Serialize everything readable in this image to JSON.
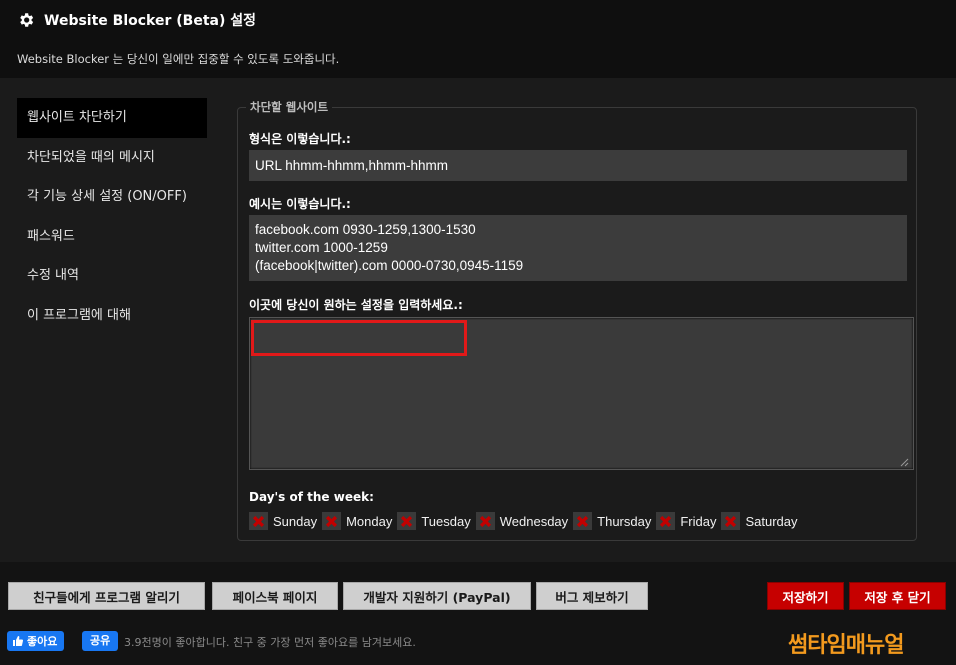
{
  "header": {
    "title": "Website Blocker (Beta) 설정",
    "subtitle": "Website Blocker 는 당신이 일에만 집중할 수 있도록 도와줍니다."
  },
  "sidebar": {
    "items": [
      {
        "label": "웹사이트 차단하기"
      },
      {
        "label": "차단되었을 때의 메시지"
      },
      {
        "label": "각 기능 상세 설정 (ON/OFF)"
      },
      {
        "label": "패스워드"
      },
      {
        "label": "수정 내역"
      },
      {
        "label": "이 프로그램에 대해"
      }
    ],
    "active_index": 0
  },
  "panel": {
    "legend": "차단할 웹사이트",
    "format_label": "형식은 이렇습니다.:",
    "format_value": "URL hhmm-hhmm,hhmm-hhmm",
    "example_label": "예시는 이렇습니다.:",
    "example_lines": [
      "facebook.com 0930-1259,1300-1530",
      "twitter.com 1000-1259",
      "(facebook|twitter).com 0000-0730,0945-1159"
    ],
    "input_label": "이곳에 당신이 원하는 설정을 입력하세요.:",
    "input_value": "",
    "days_label": "Day's of the week:",
    "days": [
      {
        "label": "Sunday",
        "checked": false
      },
      {
        "label": "Monday",
        "checked": false
      },
      {
        "label": "Tuesday",
        "checked": false
      },
      {
        "label": "Wednesday",
        "checked": false
      },
      {
        "label": "Thursday",
        "checked": false
      },
      {
        "label": "Friday",
        "checked": false
      },
      {
        "label": "Saturday",
        "checked": false
      }
    ]
  },
  "footer": {
    "buttons": {
      "tell_friends": "친구들에게 프로그램 알리기",
      "facebook_page": "페이스북 페이지",
      "support_dev": "개발자 지원하기 (PayPal)",
      "report_bug": "버그 제보하기",
      "save": "저장하기",
      "save_close": "저장 후 닫기"
    },
    "fb": {
      "like": "좋아요",
      "share": "공유",
      "text": "3.9천명이 좋아합니다. 친구 중 가장 먼저 좋아요를 남겨보세요."
    },
    "watermark": "썸타임매뉴얼"
  },
  "colors": {
    "accent_red": "#c60000",
    "highlight_red": "#e11919",
    "facebook_blue": "#1877f2",
    "watermark_orange": "#f39a1e"
  },
  "icons": {
    "title": "gear-icon",
    "checkbox": "x-mark-icon",
    "like": "thumbs-up-icon"
  }
}
